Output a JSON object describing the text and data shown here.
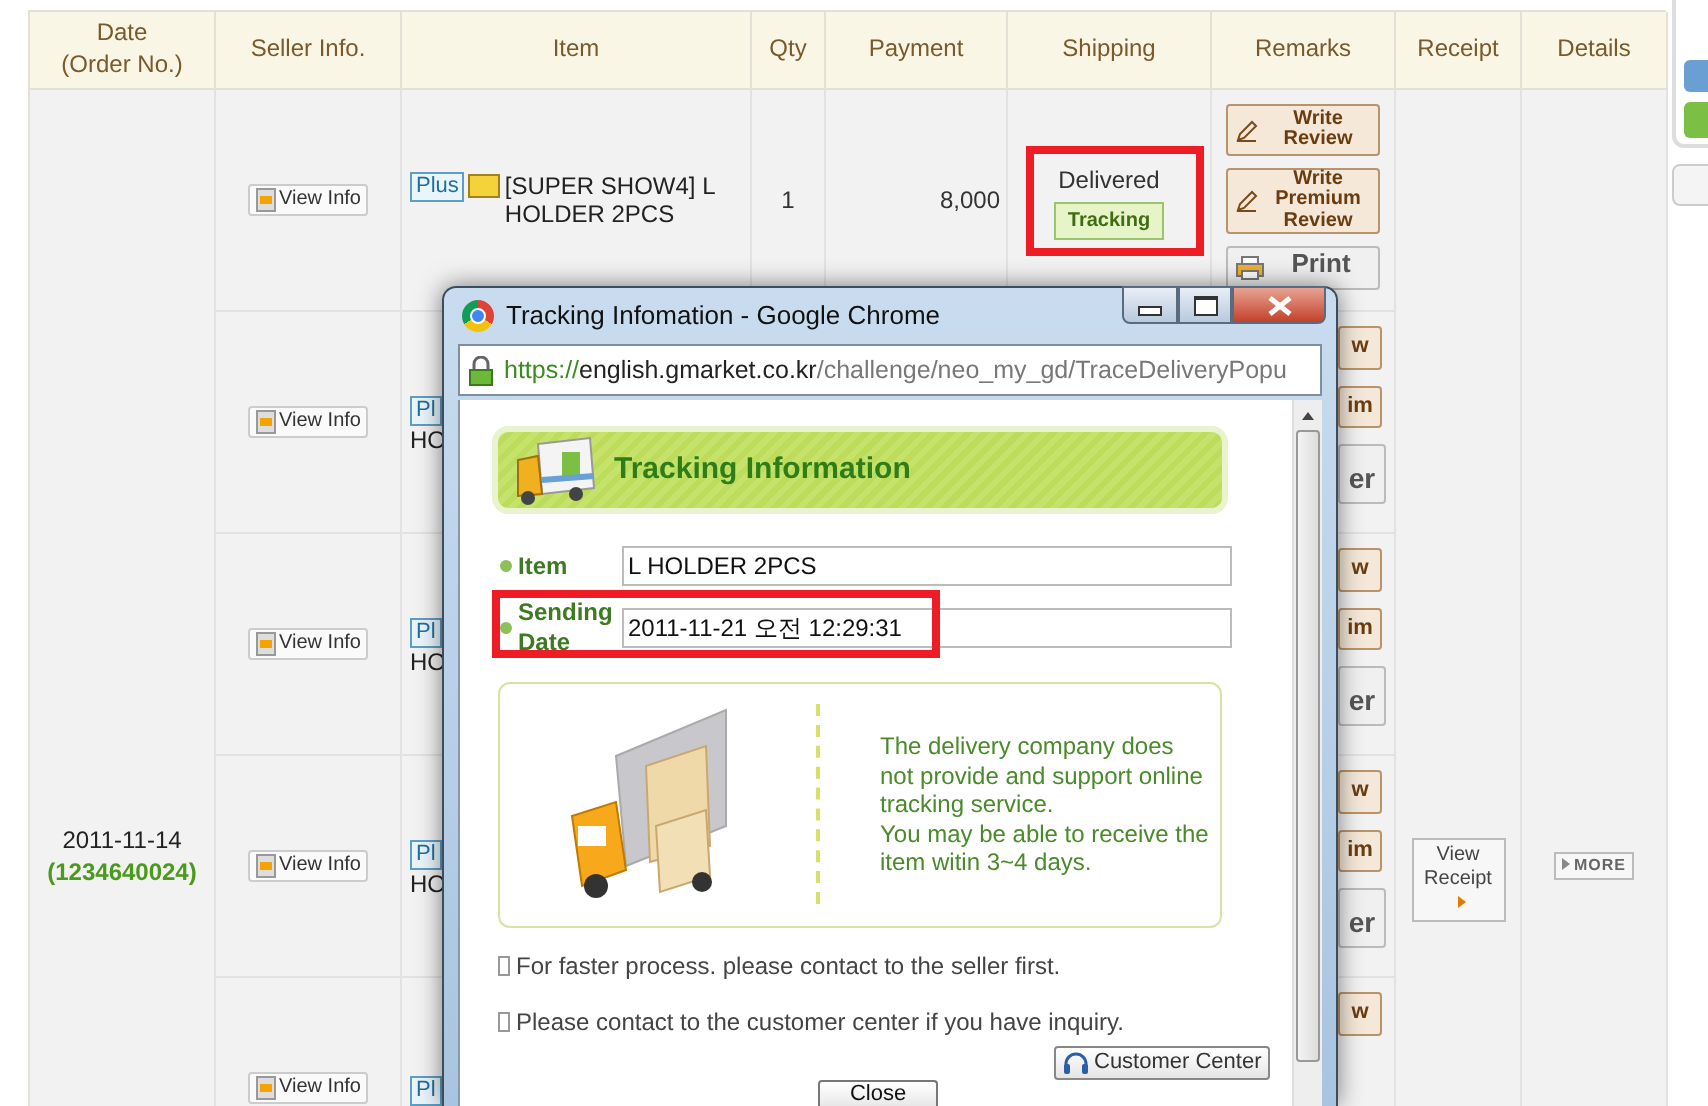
{
  "table": {
    "columns": [
      {
        "label": "Date",
        "sub": "(Order No.)"
      },
      {
        "label": "Seller Info."
      },
      {
        "label": "Item"
      },
      {
        "label": "Qty"
      },
      {
        "label": "Payment"
      },
      {
        "label": "Shipping"
      },
      {
        "label": "Remarks"
      },
      {
        "label": "Receipt"
      },
      {
        "label": "Details"
      }
    ],
    "order_date": "2011-11-14",
    "order_no": "(1234640024)",
    "receipt": "View Receipt",
    "details": "MORE",
    "rows": [
      {
        "seller": "View Info",
        "badge": "Plus",
        "item": "[SUPER SHOW4] L HOLDER 2PCS",
        "qty": "1",
        "payment": "8,000",
        "shipping": {
          "status": "Delivered",
          "tracking": "Tracking",
          "highlighted": true
        },
        "remarks": [
          {
            "kind": "review",
            "label": "Write Review"
          },
          {
            "kind": "premium",
            "label": "Write Premium Review"
          },
          {
            "kind": "print",
            "label": "Print"
          }
        ]
      },
      {
        "seller": "View Info",
        "badge": "Pl",
        "item": "HO",
        "remarks": [
          {
            "kind": "review",
            "label": "w"
          },
          {
            "kind": "premium",
            "label": "im"
          },
          {
            "kind": "print",
            "label": "er"
          }
        ]
      },
      {
        "seller": "View Info",
        "badge": "Pl",
        "item": "HO",
        "remarks": [
          {
            "kind": "review",
            "label": "w"
          },
          {
            "kind": "premium",
            "label": "im"
          },
          {
            "kind": "print",
            "label": "er"
          }
        ]
      },
      {
        "seller": "View Info",
        "badge": "Pl",
        "item": "HO",
        "remarks": [
          {
            "kind": "review",
            "label": "w"
          },
          {
            "kind": "premium",
            "label": "im"
          },
          {
            "kind": "print",
            "label": "er"
          }
        ]
      },
      {
        "seller": "View Info",
        "badge": "Pl",
        "remarks": [
          {
            "kind": "review",
            "label": "w"
          }
        ]
      }
    ]
  },
  "popup": {
    "title": "Tracking Infomation - Google Chrome",
    "url": {
      "scheme": "https://",
      "host": "english.gmarket.co.kr",
      "path": "/challenge/neo_my_gd/TraceDeliveryPopu"
    },
    "heading": "Tracking Information",
    "fields": [
      {
        "label": "Item",
        "value": "L HOLDER 2PCS",
        "highlighted": false
      },
      {
        "label": "Sending Date",
        "value": "2011-11-21 오전 12:29:31",
        "highlighted": true
      }
    ],
    "message": [
      "The delivery company does not provide and support online tracking service.",
      "You may be able to receive the item witin 3~4 days."
    ],
    "notes": [
      "For faster process. please contact to the seller first.",
      "Please contact to the customer center if you have inquiry."
    ],
    "customer_center": "Customer Center",
    "close": "Close"
  }
}
